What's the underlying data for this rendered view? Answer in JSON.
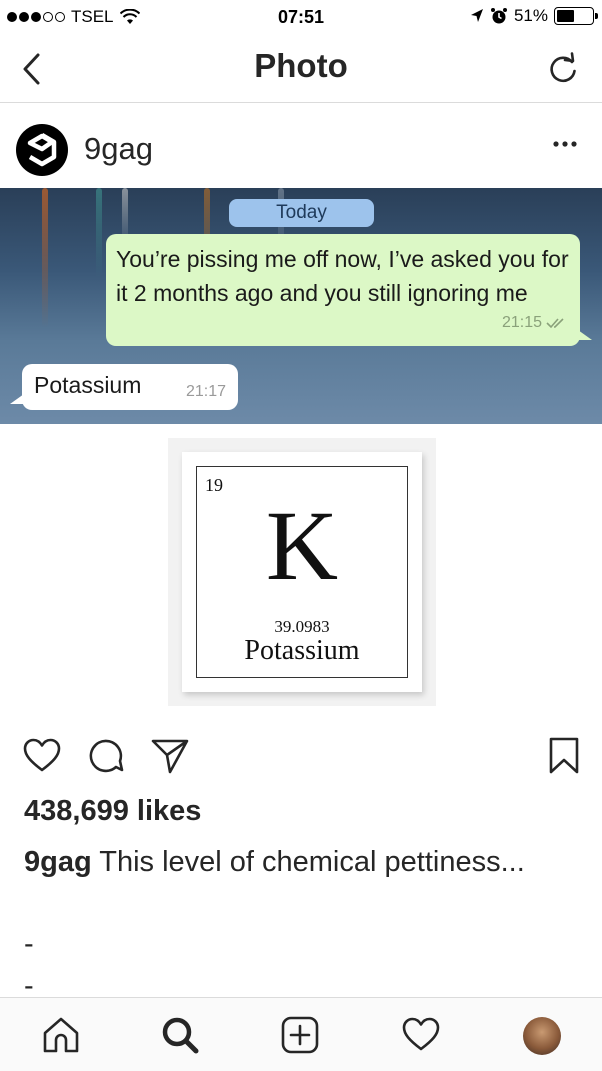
{
  "status_bar": {
    "carrier": "TSEL",
    "time": "07:51",
    "battery": "51%",
    "battery_level": 0.51
  },
  "nav": {
    "title": "Photo",
    "back_icon": "chevron-left-icon",
    "refresh_icon": "refresh-icon"
  },
  "post": {
    "username": "9gag",
    "more_icon": "ellipsis-icon"
  },
  "chat": {
    "date_label": "Today",
    "outgoing_message": "You’re pissing me off now, I’ve asked you for it 2 months ago and you still ignoring me",
    "outgoing_time": "21:15",
    "incoming_message": "Potassium",
    "incoming_time": "21:17"
  },
  "element": {
    "atomic_number": "19",
    "symbol": "K",
    "atomic_mass": "39.0983",
    "name": "Potassium"
  },
  "actions": {
    "like_icon": "heart-icon",
    "comment_icon": "comment-icon",
    "share_icon": "paper-plane-icon",
    "save_icon": "bookmark-icon"
  },
  "likes": "438,699 likes",
  "caption": {
    "user": "9gag",
    "text": "This level of chemical pettiness..."
  },
  "caption_lines": [
    "-",
    "-"
  ],
  "tabbar": {
    "home_icon": "home-icon",
    "search_icon": "search-icon",
    "add_icon": "add-post-icon",
    "activity_icon": "heart-icon",
    "profile_icon": "profile-avatar"
  }
}
